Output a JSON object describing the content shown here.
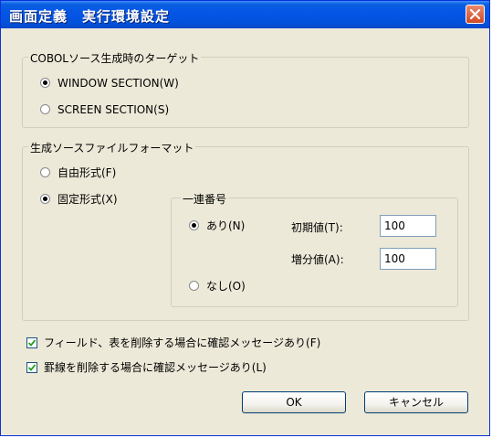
{
  "window": {
    "title": "画面定義　実行環境設定"
  },
  "cobol_target": {
    "legend": "COBOLソース生成時のターゲット",
    "options": [
      {
        "label": "WINDOW SECTION(W)",
        "selected": true
      },
      {
        "label": "SCREEN SECTION(S)",
        "selected": false
      }
    ]
  },
  "source_format": {
    "legend": "生成ソースファイルフォーマット",
    "options": [
      {
        "label": "自由形式(F)",
        "selected": false
      },
      {
        "label": "固定形式(X)",
        "selected": true
      }
    ],
    "sequence": {
      "legend": "一連番号",
      "options": [
        {
          "label": "あり(N)",
          "selected": true
        },
        {
          "label": "なし(O)",
          "selected": false
        }
      ],
      "initial_label": "初期値(T):",
      "initial_value": "100",
      "increment_label": "増分値(A):",
      "increment_value": "100"
    }
  },
  "checkboxes": [
    {
      "label": "フィールド、表を削除する場合に確認メッセージあり(F)",
      "checked": true
    },
    {
      "label": "罫線を削除する場合に確認メッセージあり(L)",
      "checked": true
    }
  ],
  "buttons": {
    "ok": "OK",
    "cancel": "キャンセル"
  },
  "colors": {
    "title_bar": "#0454e6",
    "close_button": "#d04a28",
    "dialog_bg": "#ece9d8"
  }
}
